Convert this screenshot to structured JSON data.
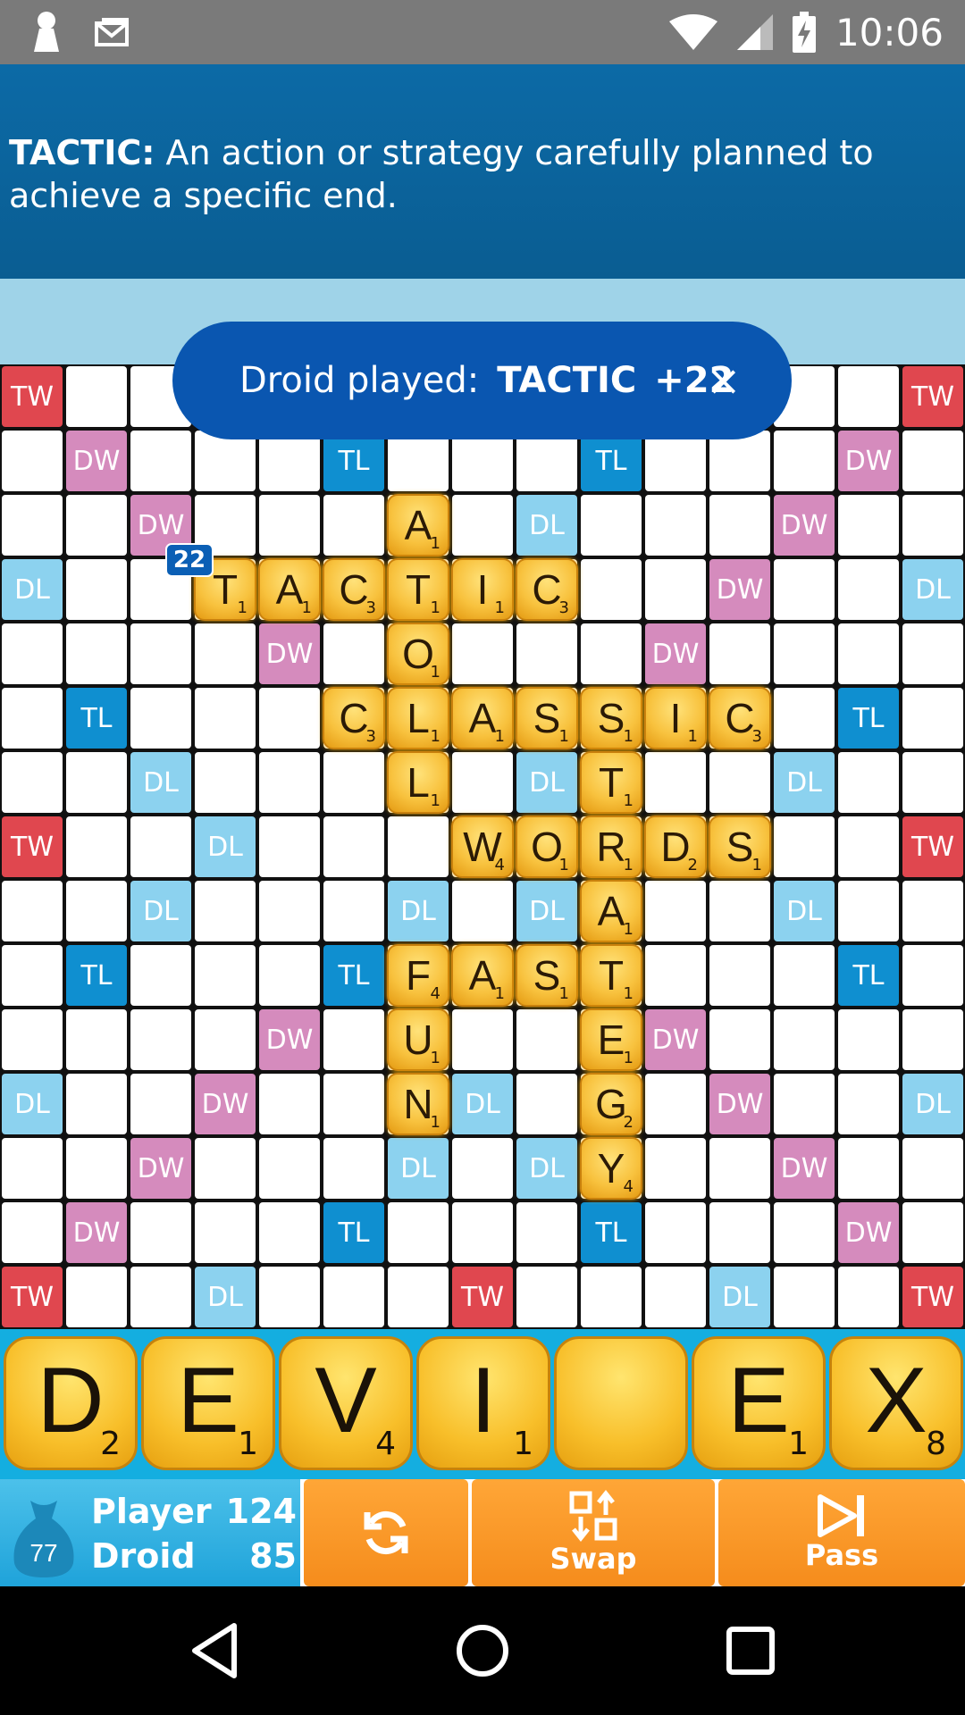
{
  "status_bar": {
    "time": "10:06",
    "left_icons": [
      "keyhole-icon",
      "mail-icon"
    ],
    "right_icons": [
      "wifi-icon",
      "signal-icon",
      "battery-charging-icon"
    ]
  },
  "definition": {
    "word": "TACTIC:",
    "text": " An action or strategy carefully planned to achieve a specific end."
  },
  "toast": {
    "label": "Droid played:",
    "word": "TACTIC",
    "points": "+22",
    "close": "×"
  },
  "last_move_badge": "22",
  "colors": {
    "TW": "#e0474f",
    "DW": "#d58bbd",
    "TL": "#0f8fd0",
    "DL": "#8cd2ef",
    "tile": "#f8c23e",
    "rack": "#14aee0",
    "button": "#f7931e"
  },
  "board": {
    "size": 15,
    "premium_rows": [
      "TW . . . . . . . . . . . . . TW",
      ". DW . . . TL . . . TL . . . DW .",
      ". . DW . . . . . DL . . . DW . .",
      "DL . . . . . . . . . . DW . . DL",
      ". . . . DW . . . . . DW . . . .",
      ". TL . . . . . . . . . . . TL .",
      ". . DL . . . . . DL . . . DL . .",
      "TW . . DL . . . . . . . . . . TW",
      ". . DL . . . DL . DL . . . DL . .",
      ". TL . . . TL . . . . . . . TL .",
      ". . . . DW . . . . . DW . . . .",
      "DL . . DW . . . DL . . . DW . . DL",
      ". . DW . . . DL . DL . . . DW . .",
      ". DW . . . TL . . . TL . . . DW .",
      "TW . . DL . . . TW . . . DL . . TW"
    ],
    "tiles": [
      {
        "r": 2,
        "c": 6,
        "letter": "A",
        "points": "1"
      },
      {
        "r": 3,
        "c": 3,
        "letter": "T",
        "points": "1"
      },
      {
        "r": 3,
        "c": 4,
        "letter": "A",
        "points": "1"
      },
      {
        "r": 3,
        "c": 5,
        "letter": "C",
        "points": "3"
      },
      {
        "r": 3,
        "c": 6,
        "letter": "T",
        "points": "1"
      },
      {
        "r": 3,
        "c": 7,
        "letter": "I",
        "points": "1"
      },
      {
        "r": 3,
        "c": 8,
        "letter": "C",
        "points": "3"
      },
      {
        "r": 4,
        "c": 6,
        "letter": "O",
        "points": "1"
      },
      {
        "r": 5,
        "c": 5,
        "letter": "C",
        "points": "3"
      },
      {
        "r": 5,
        "c": 6,
        "letter": "L",
        "points": "1"
      },
      {
        "r": 5,
        "c": 7,
        "letter": "A",
        "points": "1"
      },
      {
        "r": 5,
        "c": 8,
        "letter": "S",
        "points": "1"
      },
      {
        "r": 5,
        "c": 9,
        "letter": "S",
        "points": "1"
      },
      {
        "r": 5,
        "c": 10,
        "letter": "I",
        "points": "1"
      },
      {
        "r": 5,
        "c": 11,
        "letter": "C",
        "points": "3"
      },
      {
        "r": 6,
        "c": 6,
        "letter": "L",
        "points": "1"
      },
      {
        "r": 6,
        "c": 9,
        "letter": "T",
        "points": "1"
      },
      {
        "r": 7,
        "c": 7,
        "letter": "W",
        "points": "4"
      },
      {
        "r": 7,
        "c": 8,
        "letter": "O",
        "points": "1"
      },
      {
        "r": 7,
        "c": 9,
        "letter": "R",
        "points": "1"
      },
      {
        "r": 7,
        "c": 10,
        "letter": "D",
        "points": "2"
      },
      {
        "r": 7,
        "c": 11,
        "letter": "S",
        "points": "1"
      },
      {
        "r": 8,
        "c": 9,
        "letter": "A",
        "points": "1"
      },
      {
        "r": 9,
        "c": 6,
        "letter": "F",
        "points": "4"
      },
      {
        "r": 9,
        "c": 7,
        "letter": "A",
        "points": "1"
      },
      {
        "r": 9,
        "c": 8,
        "letter": "S",
        "points": "1"
      },
      {
        "r": 9,
        "c": 9,
        "letter": "T",
        "points": "1"
      },
      {
        "r": 10,
        "c": 6,
        "letter": "U",
        "points": "1"
      },
      {
        "r": 10,
        "c": 9,
        "letter": "E",
        "points": "1"
      },
      {
        "r": 11,
        "c": 6,
        "letter": "N",
        "points": "1"
      },
      {
        "r": 11,
        "c": 9,
        "letter": "G",
        "points": "2"
      },
      {
        "r": 12,
        "c": 9,
        "letter": "Y",
        "points": "4"
      }
    ]
  },
  "rack": [
    {
      "letter": "D",
      "points": "2"
    },
    {
      "letter": "E",
      "points": "1"
    },
    {
      "letter": "V",
      "points": "4"
    },
    {
      "letter": "I",
      "points": "1"
    },
    {
      "letter": "",
      "points": ""
    },
    {
      "letter": "E",
      "points": "1"
    },
    {
      "letter": "X",
      "points": "8"
    }
  ],
  "scores": {
    "bag_count": "77",
    "player_label": "Player",
    "player_score": "124",
    "droid_label": "Droid",
    "droid_score": "85"
  },
  "buttons": {
    "refresh_icon": "refresh-icon",
    "swap_label": "Swap",
    "pass_label": "Pass"
  },
  "nav": [
    "back-icon",
    "home-icon",
    "recents-icon"
  ]
}
